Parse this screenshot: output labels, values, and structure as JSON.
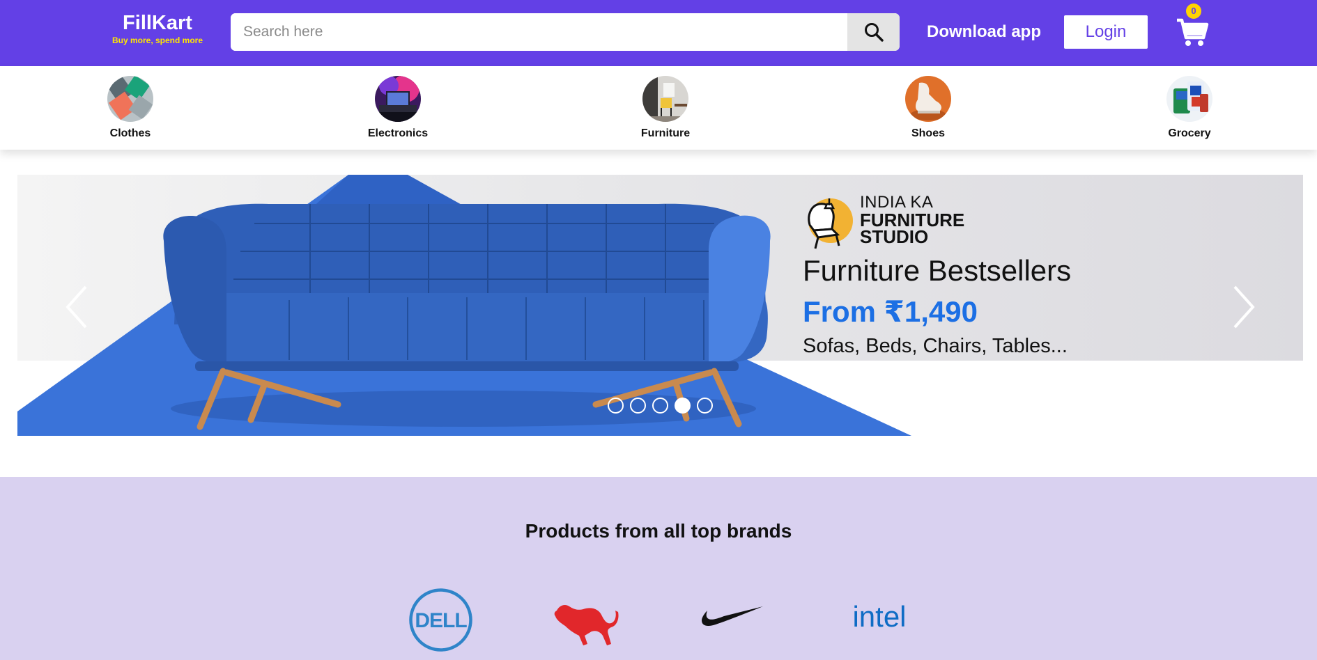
{
  "header": {
    "logo_title": "FillKart",
    "logo_tagline": "Buy more, spend more",
    "search_placeholder": "Search here",
    "download_label": "Download app",
    "login_label": "Login",
    "cart_count": "0",
    "colors": {
      "brand": "#6340e6",
      "accent": "#ffe600"
    }
  },
  "categories": [
    {
      "label": "Clothes",
      "icon": "clothes-thumbnail"
    },
    {
      "label": "Electronics",
      "icon": "electronics-thumbnail"
    },
    {
      "label": "Furniture",
      "icon": "furniture-thumbnail"
    },
    {
      "label": "Shoes",
      "icon": "shoes-thumbnail"
    },
    {
      "label": "Grocery",
      "icon": "grocery-thumbnail"
    }
  ],
  "banner": {
    "studio_line1": "INDIA KA",
    "studio_line2": "FURNITURE",
    "studio_line3": "STUDIO",
    "headline": "Furniture Bestsellers",
    "price": "From ₹1,490",
    "subtitle": "Sofas, Beds, Chairs, Tables...",
    "slide_count": 5,
    "active_slide": 4,
    "colors": {
      "price": "#1c6fe4",
      "sofa": "#2f5fb8"
    }
  },
  "brands": {
    "title": "Products from all top brands",
    "items": [
      "DELL",
      "puma-logo",
      "nike-logo",
      "intel"
    ]
  }
}
